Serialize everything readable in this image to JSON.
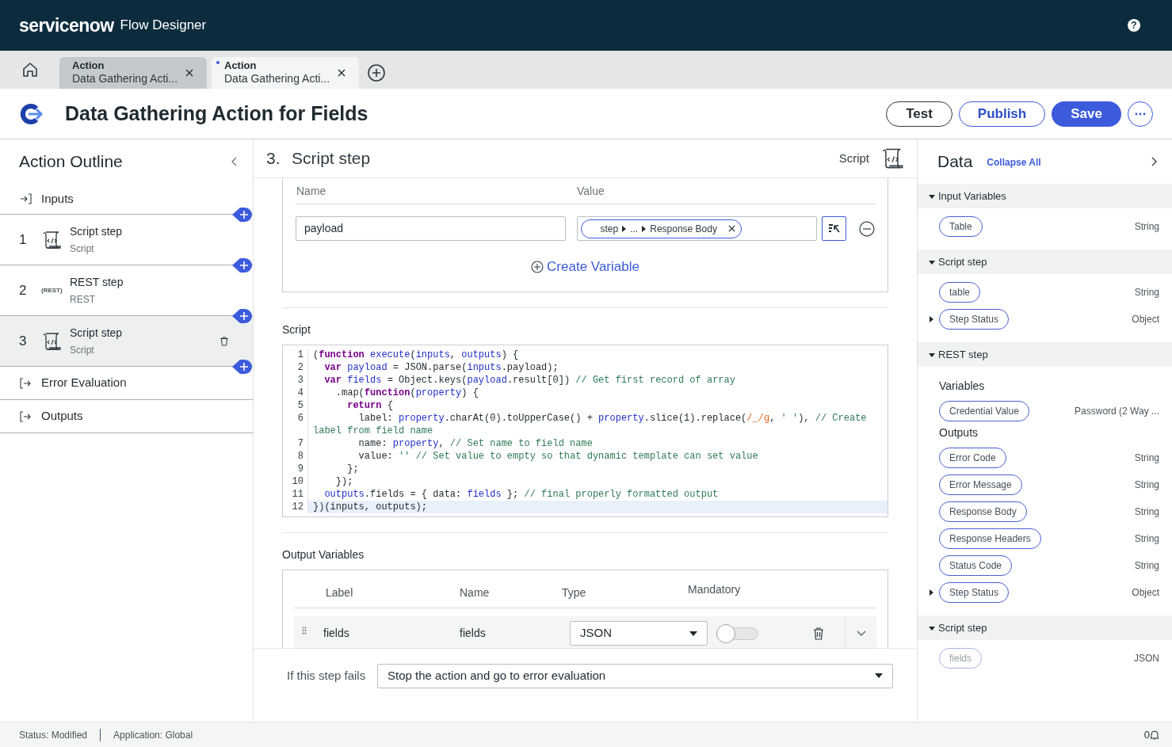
{
  "header": {
    "logo": "servicenow",
    "app_title": "Flow Designer",
    "help_button": "?"
  },
  "tabs": [
    {
      "label": "Action",
      "title": "Data Gathering Acti...",
      "selected": false,
      "modified": false
    },
    {
      "label": "Action",
      "title": "Data Gathering Acti...",
      "selected": true,
      "modified": true
    }
  ],
  "action": {
    "title": "Data Gathering Action for Fields",
    "buttons": [
      {
        "label": "Test",
        "kind": "outline"
      },
      {
        "label": "Publish",
        "kind": "outline-blue"
      },
      {
        "label": "Save",
        "kind": "primary"
      }
    ]
  },
  "outline": {
    "title": "Action Outline",
    "items": [
      {
        "kind": "input",
        "label": "Inputs",
        "selected": false
      },
      {
        "kind": "script-step",
        "number": "1",
        "title": "Script step",
        "subtitle": "Script",
        "selected": false
      },
      {
        "kind": "rest-step",
        "number": "2",
        "icon_label": "(REST)",
        "title": "REST step",
        "subtitle": "REST",
        "selected": false
      },
      {
        "kind": "script-step",
        "number": "3",
        "title": "Script step",
        "subtitle": "Script",
        "selected": true
      },
      {
        "kind": "output",
        "label": "Error Evaluation",
        "selected": false
      },
      {
        "kind": "output",
        "label": "Outputs",
        "selected": false
      }
    ]
  },
  "step": {
    "number": "3.",
    "title": "Script step",
    "type_label": "Script",
    "inputs": {
      "columns": [
        "Name",
        "Value"
      ],
      "rows": [
        {
          "name": "payload",
          "value_pills": [
            "step",
            "...",
            "Response Body"
          ]
        }
      ],
      "create_link": "Create Variable"
    },
    "script_label": "Script",
    "code": [
      {
        "n": "1",
        "active": false,
        "parts": [
          {
            "text": "("
          },
          {
            "text": "function",
            "kind": "keyword"
          },
          {
            "text": " execute",
            "kind": "variable"
          },
          {
            "text": "("
          },
          {
            "text": "inputs",
            "kind": "variable"
          },
          {
            "text": ", "
          },
          {
            "text": "outputs",
            "kind": "variable"
          },
          {
            "text": ") {"
          }
        ]
      },
      {
        "n": "2",
        "active": false,
        "parts": [
          {
            "text": "  var",
            "kind": "keyword"
          },
          {
            "text": " payload",
            "kind": "variable"
          },
          {
            "text": " = JSON.parse("
          },
          {
            "text": "inputs",
            "kind": "variable"
          },
          {
            "text": ".payload);"
          }
        ]
      },
      {
        "n": "3",
        "active": false,
        "parts": [
          {
            "text": "  var",
            "kind": "keyword"
          },
          {
            "text": " fields",
            "kind": "variable"
          },
          {
            "text": " = Object.keys("
          },
          {
            "text": "payload",
            "kind": "variable"
          },
          {
            "text": ".result[0]) "
          },
          {
            "text": "// Get first record of array",
            "kind": "comment"
          }
        ]
      },
      {
        "n": "4",
        "active": false,
        "parts": [
          {
            "text": "    .map("
          },
          {
            "text": "function",
            "kind": "keyword"
          },
          {
            "text": "("
          },
          {
            "text": "property",
            "kind": "variable"
          },
          {
            "text": ") {"
          }
        ]
      },
      {
        "n": "5",
        "active": false,
        "parts": [
          {
            "text": "      return",
            "kind": "keyword"
          },
          {
            "text": " {"
          }
        ]
      },
      {
        "n": "6",
        "active": false,
        "parts": [
          {
            "text": "        label: "
          },
          {
            "text": "property",
            "kind": "variable"
          },
          {
            "text": ".charAt(0).toUpperCase() + "
          },
          {
            "text": "property",
            "kind": "variable"
          },
          {
            "text": ".slice(1).replace("
          },
          {
            "text": "/_/g",
            "kind": "regex"
          },
          {
            "text": ", "
          },
          {
            "text": "' '",
            "kind": "string"
          },
          {
            "text": "), "
          },
          {
            "text": "// Create label from field name",
            "kind": "comment"
          }
        ]
      },
      {
        "n": "7",
        "active": false,
        "parts": [
          {
            "text": "        name: "
          },
          {
            "text": "property",
            "kind": "variable"
          },
          {
            "text": ", "
          },
          {
            "text": "// Set name to field name",
            "kind": "comment"
          }
        ]
      },
      {
        "n": "8",
        "active": false,
        "parts": [
          {
            "text": "        value: "
          },
          {
            "text": "''",
            "kind": "string"
          },
          {
            "text": " // Set value to empty so that dynamic template can set value",
            "kind": "comment"
          }
        ]
      },
      {
        "n": "9",
        "active": false,
        "parts": [
          {
            "text": "      };"
          }
        ]
      },
      {
        "n": "10",
        "active": false,
        "parts": [
          {
            "text": "    });"
          }
        ]
      },
      {
        "n": "11",
        "active": false,
        "parts": [
          {
            "text": "  outputs",
            "kind": "variable"
          },
          {
            "text": ".fields = { data: "
          },
          {
            "text": "fields",
            "kind": "variable"
          },
          {
            "text": " }; "
          },
          {
            "text": "// final properly formatted output",
            "kind": "comment"
          }
        ]
      },
      {
        "n": "12",
        "active": true,
        "parts": [
          {
            "text": "})(inputs, outputs);"
          }
        ]
      }
    ],
    "outputs": {
      "title": "Output Variables",
      "columns": [
        "Label",
        "Name",
        "Type",
        "Mandatory"
      ],
      "rows": [
        {
          "label": "fields",
          "name": "fields",
          "type": "JSON",
          "mandatory": false
        }
      ]
    },
    "fail": {
      "label": "If this step fails",
      "value": "Stop the action and go to error evaluation"
    }
  },
  "data": {
    "title": "Data",
    "collapse_link": "Collapse All",
    "sections": [
      {
        "title": "Input Variables",
        "expanded": true,
        "items": [
          {
            "kind": "pill",
            "label": "Table",
            "type": "String",
            "expandable": false,
            "disabled": false
          }
        ]
      },
      {
        "title": "Script step",
        "expanded": true,
        "items": [
          {
            "kind": "pill",
            "label": "table",
            "type": "String",
            "expandable": false,
            "disabled": false
          },
          {
            "kind": "pill",
            "label": "Step Status",
            "type": "Object",
            "expandable": true,
            "disabled": false
          }
        ]
      },
      {
        "title": "REST step",
        "expanded": true,
        "items": [
          {
            "kind": "heading",
            "label": "Variables"
          },
          {
            "kind": "pill",
            "label": "Credential Value",
            "type": "Password (2 Way ...",
            "expandable": false,
            "disabled": false
          },
          {
            "kind": "heading",
            "label": "Outputs"
          },
          {
            "kind": "pill",
            "label": "Error Code",
            "type": "String",
            "expandable": false,
            "disabled": false
          },
          {
            "kind": "pill",
            "label": "Error Message",
            "type": "String",
            "expandable": false,
            "disabled": false
          },
          {
            "kind": "pill",
            "label": "Response Body",
            "type": "String",
            "expandable": false,
            "disabled": false
          },
          {
            "kind": "pill",
            "label": "Response Headers",
            "type": "String",
            "expandable": false,
            "disabled": false
          },
          {
            "kind": "pill",
            "label": "Status Code",
            "type": "String",
            "expandable": false,
            "disabled": false
          },
          {
            "kind": "pill",
            "label": "Step Status",
            "type": "Object",
            "expandable": true,
            "disabled": false
          }
        ]
      },
      {
        "title": "Script step",
        "expanded": true,
        "items": [
          {
            "kind": "pill",
            "label": "fields",
            "type": "JSON",
            "expandable": false,
            "disabled": true
          }
        ]
      }
    ]
  },
  "status_bar": {
    "status": "Status: Modified",
    "application": "Application: Global",
    "notifications": "0"
  }
}
